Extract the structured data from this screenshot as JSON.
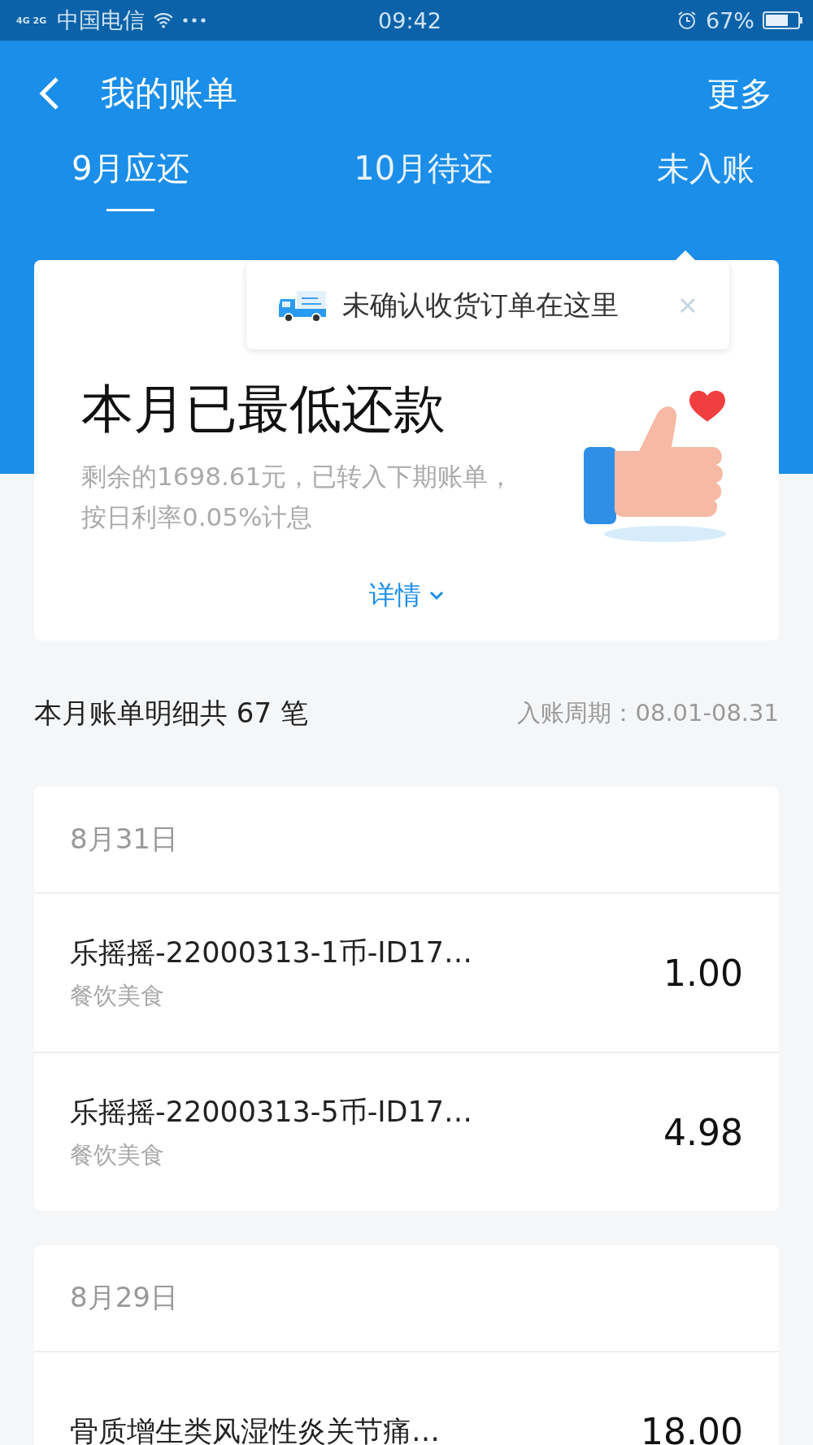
{
  "status_bar": {
    "network": "4G 2G",
    "carrier": "中国电信",
    "time": "09:42",
    "battery": "67%"
  },
  "nav": {
    "title": "我的账单",
    "more": "更多"
  },
  "tabs": [
    {
      "label": "9月应还",
      "selected": true
    },
    {
      "label": "10月待还",
      "selected": false
    },
    {
      "label": "未入账",
      "selected": false
    }
  ],
  "tooltip": {
    "text": "未确认收货订单在这里"
  },
  "summary": {
    "title": "本月已最低还款",
    "description": "剩余的1698.61元，已转入下期账单，按日利率0.05%计息",
    "details": "详情"
  },
  "list_header": {
    "count": "本月账单明细共 67 笔",
    "period": "入账周期：08.01-08.31"
  },
  "groups": [
    {
      "date": "8月31日",
      "items": [
        {
          "name": "乐摇摇-22000313-1币-ID17…",
          "category": "餐饮美食",
          "amount": "1.00"
        },
        {
          "name": "乐摇摇-22000313-5币-ID17…",
          "category": "餐饮美食",
          "amount": "4.98"
        }
      ]
    },
    {
      "date": "8月29日",
      "items": [
        {
          "name": "骨质增生类风湿性炎关节痛…",
          "amount": "18.00"
        }
      ]
    }
  ]
}
